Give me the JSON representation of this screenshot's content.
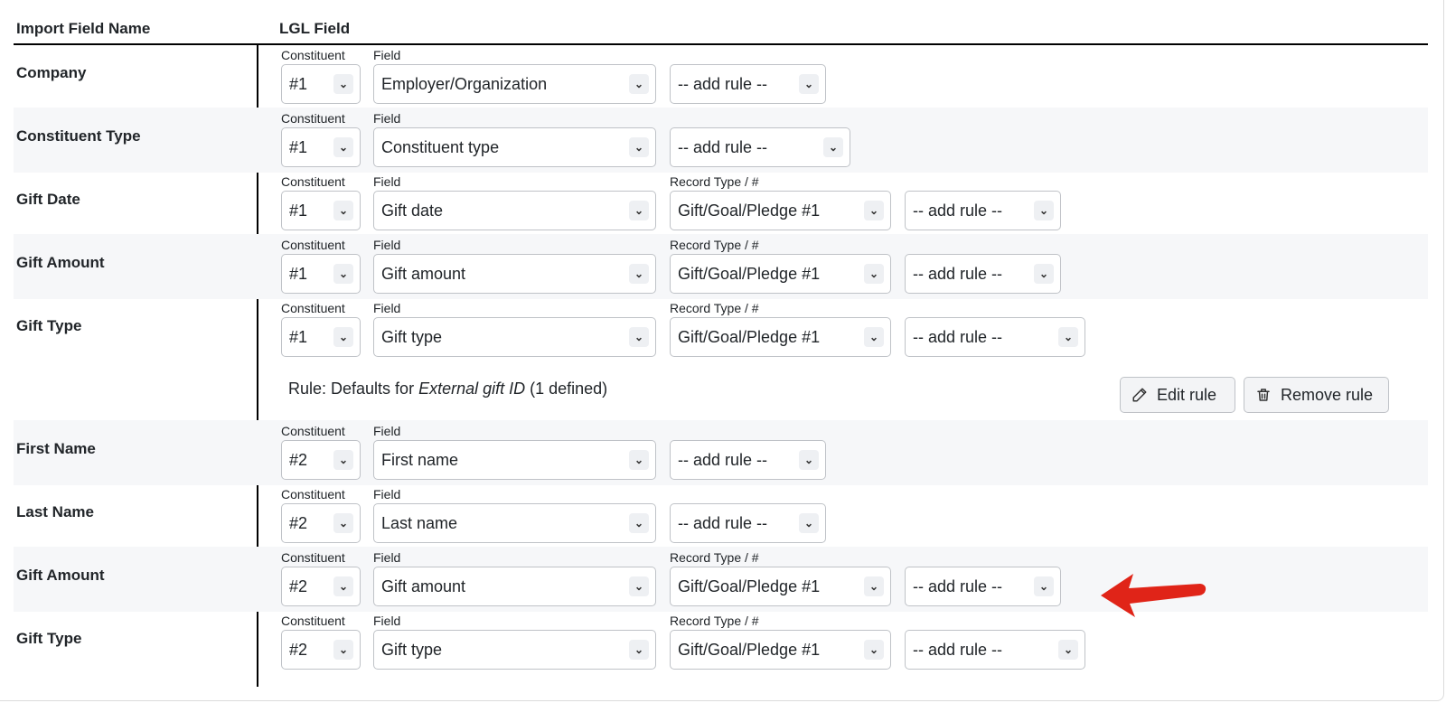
{
  "header": {
    "import_col": "Import Field Name",
    "lgl_col": "LGL Field"
  },
  "captions": {
    "constituent": "Constituent",
    "field": "Field",
    "record": "Record Type / #"
  },
  "rows": [
    {
      "name": "Company",
      "constituent": "#1",
      "field": "Employer/Organization",
      "record": "",
      "rule": "-- add rule --"
    },
    {
      "name": "Constituent Type",
      "constituent": "#1",
      "field": "Constituent type",
      "record": "",
      "rule": "-- add rule --"
    },
    {
      "name": "Gift Date",
      "constituent": "#1",
      "field": "Gift date",
      "record": "Gift/Goal/Pledge #1",
      "rule": "-- add rule --"
    },
    {
      "name": "Gift Amount",
      "constituent": "#1",
      "field": "Gift amount",
      "record": "Gift/Goal/Pledge #1",
      "rule": "-- add rule --"
    },
    {
      "name": "Gift Type",
      "constituent": "#1",
      "field": "Gift type",
      "record": "Gift/Goal/Pledge #1",
      "rule": "-- add rule --"
    },
    {
      "name": "First Name",
      "constituent": "#2",
      "field": "First name",
      "record": "",
      "rule": "-- add rule --"
    },
    {
      "name": "Last Name",
      "constituent": "#2",
      "field": "Last name",
      "record": "",
      "rule": "-- add rule --"
    },
    {
      "name": "Gift Amount",
      "constituent": "#2",
      "field": "Gift amount",
      "record": "Gift/Goal/Pledge #1",
      "rule": "-- add rule --"
    },
    {
      "name": "Gift Type",
      "constituent": "#2",
      "field": "Gift type",
      "record": "Gift/Goal/Pledge #1",
      "rule": "-- add rule --"
    }
  ],
  "rule_info": {
    "prefix": "Rule: Defaults for ",
    "field": "External gift ID",
    "suffix": " (1 defined)",
    "edit_label": "Edit rule",
    "remove_label": "Remove rule"
  },
  "icons": {
    "chevron": "chevron-down-icon",
    "edit": "pencil-icon",
    "remove": "trash-icon",
    "annotation": "red-arrow-icon"
  },
  "colors": {
    "arrow": "#e02418",
    "row_shade": "#f6f7f9"
  }
}
